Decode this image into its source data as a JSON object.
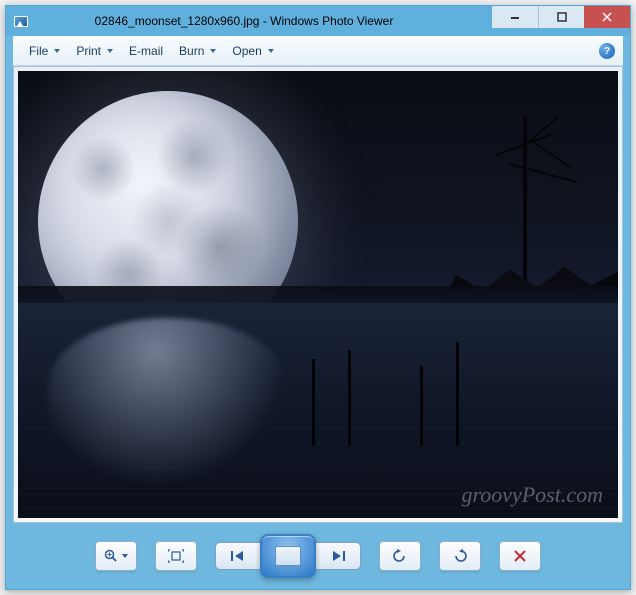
{
  "titlebar": {
    "title": "02846_moonset_1280x960.jpg - Windows Photo Viewer"
  },
  "menubar": {
    "file": "File",
    "print": "Print",
    "email": "E-mail",
    "burn": "Burn",
    "open": "Open"
  },
  "watermark": "groovyPost.com"
}
